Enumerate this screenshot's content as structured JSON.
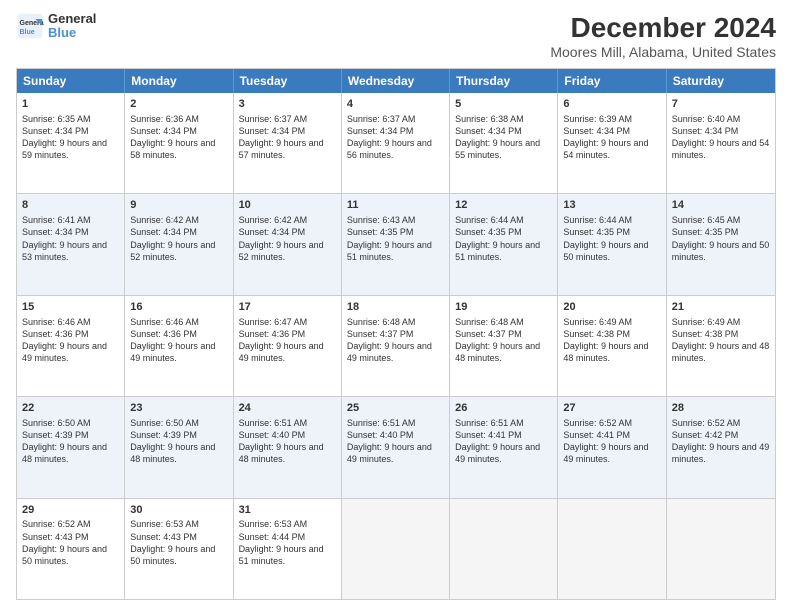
{
  "logo": {
    "line1": "General",
    "line2": "Blue"
  },
  "title": "December 2024",
  "subtitle": "Moores Mill, Alabama, United States",
  "weekdays": [
    "Sunday",
    "Monday",
    "Tuesday",
    "Wednesday",
    "Thursday",
    "Friday",
    "Saturday"
  ],
  "rows": [
    [
      {
        "day": "1",
        "sunrise": "Sunrise: 6:35 AM",
        "sunset": "Sunset: 4:34 PM",
        "daylight": "Daylight: 9 hours and 59 minutes."
      },
      {
        "day": "2",
        "sunrise": "Sunrise: 6:36 AM",
        "sunset": "Sunset: 4:34 PM",
        "daylight": "Daylight: 9 hours and 58 minutes."
      },
      {
        "day": "3",
        "sunrise": "Sunrise: 6:37 AM",
        "sunset": "Sunset: 4:34 PM",
        "daylight": "Daylight: 9 hours and 57 minutes."
      },
      {
        "day": "4",
        "sunrise": "Sunrise: 6:37 AM",
        "sunset": "Sunset: 4:34 PM",
        "daylight": "Daylight: 9 hours and 56 minutes."
      },
      {
        "day": "5",
        "sunrise": "Sunrise: 6:38 AM",
        "sunset": "Sunset: 4:34 PM",
        "daylight": "Daylight: 9 hours and 55 minutes."
      },
      {
        "day": "6",
        "sunrise": "Sunrise: 6:39 AM",
        "sunset": "Sunset: 4:34 PM",
        "daylight": "Daylight: 9 hours and 54 minutes."
      },
      {
        "day": "7",
        "sunrise": "Sunrise: 6:40 AM",
        "sunset": "Sunset: 4:34 PM",
        "daylight": "Daylight: 9 hours and 54 minutes."
      }
    ],
    [
      {
        "day": "8",
        "sunrise": "Sunrise: 6:41 AM",
        "sunset": "Sunset: 4:34 PM",
        "daylight": "Daylight: 9 hours and 53 minutes."
      },
      {
        "day": "9",
        "sunrise": "Sunrise: 6:42 AM",
        "sunset": "Sunset: 4:34 PM",
        "daylight": "Daylight: 9 hours and 52 minutes."
      },
      {
        "day": "10",
        "sunrise": "Sunrise: 6:42 AM",
        "sunset": "Sunset: 4:34 PM",
        "daylight": "Daylight: 9 hours and 52 minutes."
      },
      {
        "day": "11",
        "sunrise": "Sunrise: 6:43 AM",
        "sunset": "Sunset: 4:35 PM",
        "daylight": "Daylight: 9 hours and 51 minutes."
      },
      {
        "day": "12",
        "sunrise": "Sunrise: 6:44 AM",
        "sunset": "Sunset: 4:35 PM",
        "daylight": "Daylight: 9 hours and 51 minutes."
      },
      {
        "day": "13",
        "sunrise": "Sunrise: 6:44 AM",
        "sunset": "Sunset: 4:35 PM",
        "daylight": "Daylight: 9 hours and 50 minutes."
      },
      {
        "day": "14",
        "sunrise": "Sunrise: 6:45 AM",
        "sunset": "Sunset: 4:35 PM",
        "daylight": "Daylight: 9 hours and 50 minutes."
      }
    ],
    [
      {
        "day": "15",
        "sunrise": "Sunrise: 6:46 AM",
        "sunset": "Sunset: 4:36 PM",
        "daylight": "Daylight: 9 hours and 49 minutes."
      },
      {
        "day": "16",
        "sunrise": "Sunrise: 6:46 AM",
        "sunset": "Sunset: 4:36 PM",
        "daylight": "Daylight: 9 hours and 49 minutes."
      },
      {
        "day": "17",
        "sunrise": "Sunrise: 6:47 AM",
        "sunset": "Sunset: 4:36 PM",
        "daylight": "Daylight: 9 hours and 49 minutes."
      },
      {
        "day": "18",
        "sunrise": "Sunrise: 6:48 AM",
        "sunset": "Sunset: 4:37 PM",
        "daylight": "Daylight: 9 hours and 49 minutes."
      },
      {
        "day": "19",
        "sunrise": "Sunrise: 6:48 AM",
        "sunset": "Sunset: 4:37 PM",
        "daylight": "Daylight: 9 hours and 48 minutes."
      },
      {
        "day": "20",
        "sunrise": "Sunrise: 6:49 AM",
        "sunset": "Sunset: 4:38 PM",
        "daylight": "Daylight: 9 hours and 48 minutes."
      },
      {
        "day": "21",
        "sunrise": "Sunrise: 6:49 AM",
        "sunset": "Sunset: 4:38 PM",
        "daylight": "Daylight: 9 hours and 48 minutes."
      }
    ],
    [
      {
        "day": "22",
        "sunrise": "Sunrise: 6:50 AM",
        "sunset": "Sunset: 4:39 PM",
        "daylight": "Daylight: 9 hours and 48 minutes."
      },
      {
        "day": "23",
        "sunrise": "Sunrise: 6:50 AM",
        "sunset": "Sunset: 4:39 PM",
        "daylight": "Daylight: 9 hours and 48 minutes."
      },
      {
        "day": "24",
        "sunrise": "Sunrise: 6:51 AM",
        "sunset": "Sunset: 4:40 PM",
        "daylight": "Daylight: 9 hours and 48 minutes."
      },
      {
        "day": "25",
        "sunrise": "Sunrise: 6:51 AM",
        "sunset": "Sunset: 4:40 PM",
        "daylight": "Daylight: 9 hours and 49 minutes."
      },
      {
        "day": "26",
        "sunrise": "Sunrise: 6:51 AM",
        "sunset": "Sunset: 4:41 PM",
        "daylight": "Daylight: 9 hours and 49 minutes."
      },
      {
        "day": "27",
        "sunrise": "Sunrise: 6:52 AM",
        "sunset": "Sunset: 4:41 PM",
        "daylight": "Daylight: 9 hours and 49 minutes."
      },
      {
        "day": "28",
        "sunrise": "Sunrise: 6:52 AM",
        "sunset": "Sunset: 4:42 PM",
        "daylight": "Daylight: 9 hours and 49 minutes."
      }
    ],
    [
      {
        "day": "29",
        "sunrise": "Sunrise: 6:52 AM",
        "sunset": "Sunset: 4:43 PM",
        "daylight": "Daylight: 9 hours and 50 minutes."
      },
      {
        "day": "30",
        "sunrise": "Sunrise: 6:53 AM",
        "sunset": "Sunset: 4:43 PM",
        "daylight": "Daylight: 9 hours and 50 minutes."
      },
      {
        "day": "31",
        "sunrise": "Sunrise: 6:53 AM",
        "sunset": "Sunset: 4:44 PM",
        "daylight": "Daylight: 9 hours and 51 minutes."
      },
      null,
      null,
      null,
      null
    ]
  ]
}
